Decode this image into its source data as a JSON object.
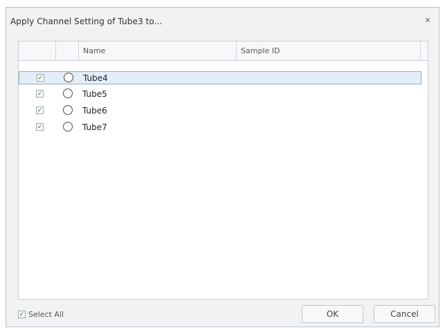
{
  "dialog": {
    "title": "Apply Channel Setting of Tube3 to...",
    "close_icon": "close-icon"
  },
  "grid": {
    "columns": [
      "",
      "",
      "Name",
      "Sample ID"
    ],
    "rows": [
      {
        "checked": true,
        "name": "Tube4",
        "sample_id": "",
        "selected": true
      },
      {
        "checked": true,
        "name": "Tube5",
        "sample_id": "",
        "selected": false
      },
      {
        "checked": true,
        "name": "Tube6",
        "sample_id": "",
        "selected": false
      },
      {
        "checked": true,
        "name": "Tube7",
        "sample_id": "",
        "selected": false
      }
    ]
  },
  "footer": {
    "select_all_label": "Select All",
    "select_all_checked": true,
    "ok_label": "OK",
    "cancel_label": "Cancel"
  }
}
